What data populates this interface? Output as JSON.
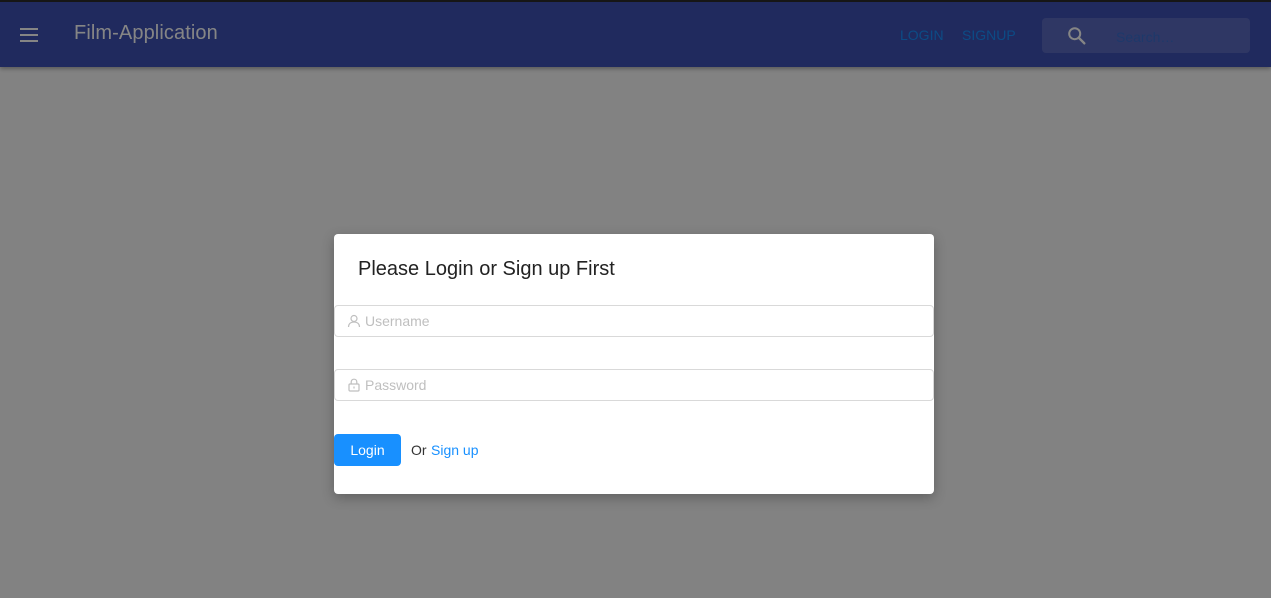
{
  "app": {
    "title": "Film-Application"
  },
  "nav": {
    "login_label": "LOGIN",
    "signup_label": "SIGNUP"
  },
  "search": {
    "placeholder": "Search…",
    "icon": "search-icon"
  },
  "modal": {
    "title": "Please Login or Sign up First",
    "username_placeholder": "Username",
    "password_placeholder": "Password",
    "login_button": "Login",
    "or_text": "Or",
    "signup_link": "Sign up"
  },
  "icons": {
    "menu": "menu-icon",
    "user": "user-icon",
    "lock": "lock-icon"
  },
  "colors": {
    "appbar": "#3f51b5",
    "accent": "#1890ff",
    "overlay": "rgba(0,0,0,0.48)"
  }
}
